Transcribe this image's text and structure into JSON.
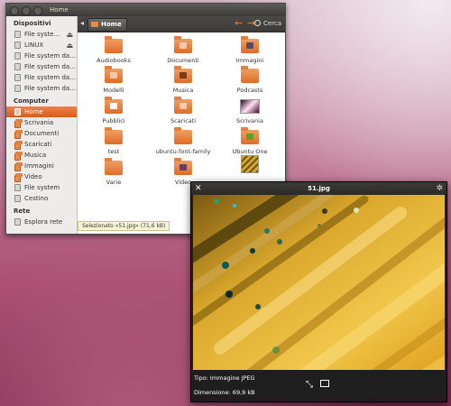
{
  "window": {
    "title": "Home"
  },
  "sidebar": {
    "sections": [
      {
        "header": "Dispositivi",
        "items": [
          {
            "label": "File syste…",
            "icon": "drive-icon",
            "eject": true
          },
          {
            "label": "LINUX",
            "icon": "drive-icon",
            "eject": true
          },
          {
            "label": "File system da…",
            "icon": "drive-icon"
          },
          {
            "label": "File system da…",
            "icon": "drive-icon"
          },
          {
            "label": "File system da…",
            "icon": "drive-icon"
          },
          {
            "label": "File system da…",
            "icon": "drive-icon"
          }
        ]
      },
      {
        "header": "Computer",
        "items": [
          {
            "label": "Home",
            "icon": "home-icon",
            "active": true
          },
          {
            "label": "Scrivania",
            "icon": "folder-icon"
          },
          {
            "label": "Documenti",
            "icon": "folder-icon"
          },
          {
            "label": "Scaricati",
            "icon": "folder-icon"
          },
          {
            "label": "Musica",
            "icon": "folder-icon"
          },
          {
            "label": "Immagini",
            "icon": "folder-icon"
          },
          {
            "label": "Video",
            "icon": "folder-icon"
          },
          {
            "label": "File system",
            "icon": "drive-icon"
          },
          {
            "label": "Cestino",
            "icon": "trash-icon"
          }
        ]
      },
      {
        "header": "Rete",
        "items": [
          {
            "label": "Esplora rete",
            "icon": "network-icon"
          }
        ]
      }
    ]
  },
  "toolbar": {
    "breadcrumb": "Home",
    "search_label": "Cerca"
  },
  "files": [
    {
      "label": "Audiobooks",
      "kind": "folder"
    },
    {
      "label": "Documenti",
      "kind": "folder-doc"
    },
    {
      "label": "Immagini",
      "kind": "folder-img"
    },
    {
      "label": "Modelli",
      "kind": "folder-doc"
    },
    {
      "label": "Musica",
      "kind": "folder-music"
    },
    {
      "label": "Podcasts",
      "kind": "folder"
    },
    {
      "label": "Pubblici",
      "kind": "folder-user"
    },
    {
      "label": "Scaricati",
      "kind": "folder-down"
    },
    {
      "label": "Scrivania",
      "kind": "image-thumb"
    },
    {
      "label": "test",
      "kind": "folder"
    },
    {
      "label": "ubuntu-font-family",
      "kind": "folder"
    },
    {
      "label": "Ubuntu One",
      "kind": "folder-check"
    },
    {
      "label": "Varie",
      "kind": "folder"
    },
    {
      "label": "Video",
      "kind": "folder-video"
    },
    {
      "label": "",
      "kind": "image-thumb-2"
    }
  ],
  "status": {
    "text": "Selezionato «51.jpg» (71,6 kB)"
  },
  "viewer": {
    "title": "51.jpg",
    "type_label": "Tipo: Immagine JPEG",
    "size_label": "Dimensione: 69,9 kB"
  }
}
